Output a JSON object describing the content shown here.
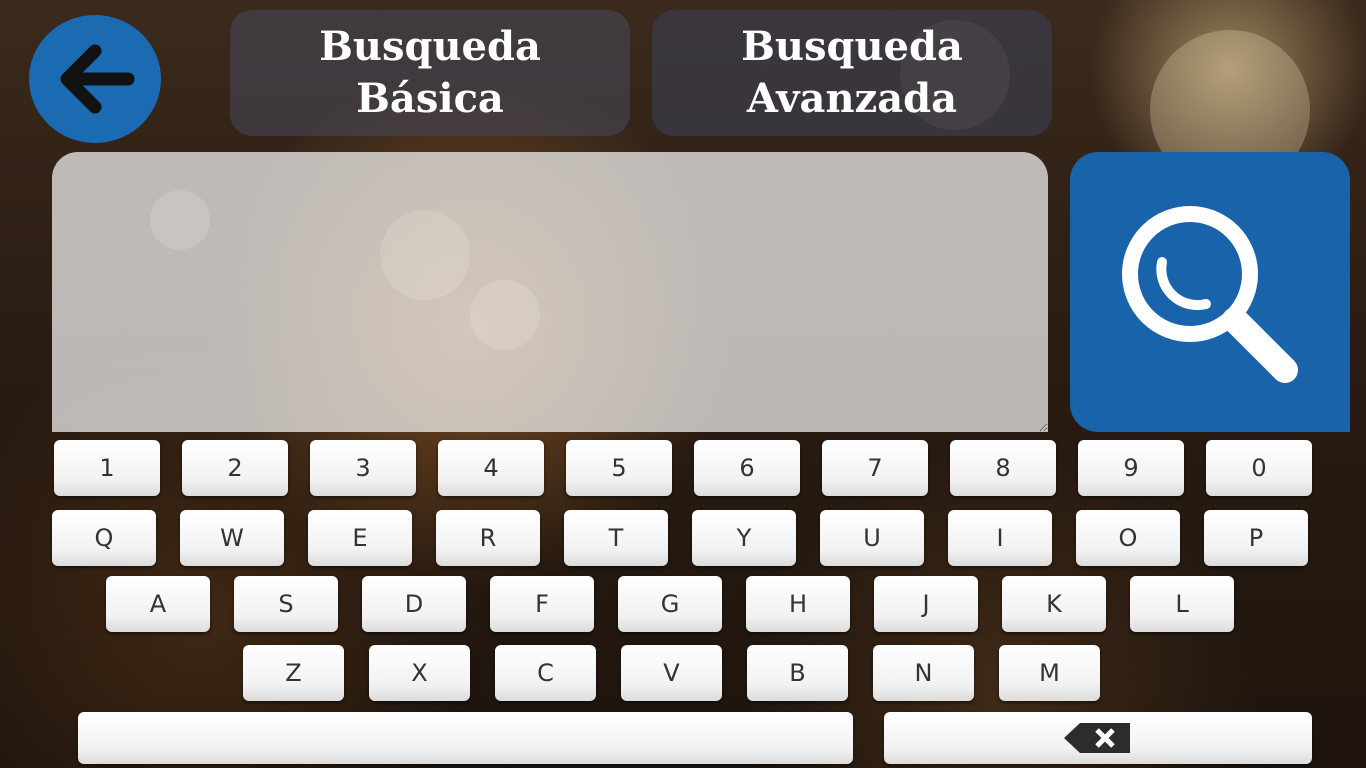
{
  "header": {
    "back_icon": "arrow-left-icon",
    "tabs": [
      {
        "line1": "Busqueda",
        "line2": "Básica"
      },
      {
        "line1": "Busqueda",
        "line2": "Avanzada"
      }
    ]
  },
  "search": {
    "value": "",
    "button_icon": "magnifier-icon"
  },
  "keyboard": {
    "row1": [
      "1",
      "2",
      "3",
      "4",
      "5",
      "6",
      "7",
      "8",
      "9",
      "0"
    ],
    "row2": [
      "Q",
      "W",
      "E",
      "R",
      "T",
      "Y",
      "U",
      "I",
      "O",
      "P"
    ],
    "row3": [
      "A",
      "S",
      "D",
      "F",
      "G",
      "H",
      "J",
      "K",
      "L"
    ],
    "row4": [
      "Z",
      "X",
      "C",
      "V",
      "B",
      "N",
      "M"
    ],
    "space_label": "",
    "backspace_icon": "backspace-icon"
  },
  "colors": {
    "accent_blue": "#1b6bb3",
    "search_blue": "#1963ab",
    "tab_bg": "#3c3c4b"
  }
}
